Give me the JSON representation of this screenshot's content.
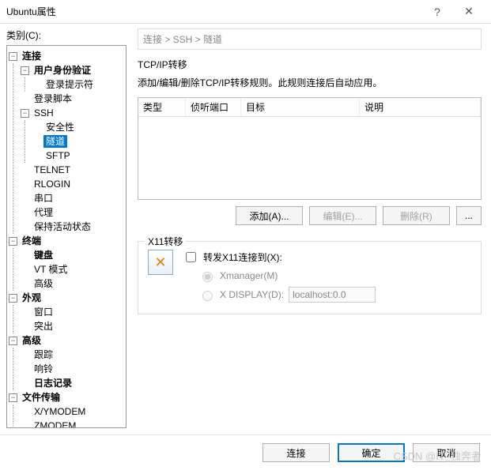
{
  "title": "Ubuntu属性",
  "leftLabel": "类别(C):",
  "breadcrumb": "连接 > SSH > 隧道",
  "tcpip": {
    "title": "TCP/IP转移",
    "desc": "添加/编辑/删除TCP/IP转移规则。此规则连接后自动应用。",
    "cols": {
      "type": "类型",
      "port": "侦听端口",
      "dest": "目标",
      "desc": "说明"
    },
    "btnAdd": "添加(A)...",
    "btnEdit": "编辑(E)...",
    "btnRemove": "删除(R)",
    "btnMore": "..."
  },
  "x11": {
    "title": "X11转移",
    "check": "转发X11连接到(X):",
    "optXmanager": "Xmanager(M)",
    "optDisplay": "X DISPLAY(D):",
    "displayValue": "localhost:0.0"
  },
  "footer": {
    "connect": "连接",
    "ok": "确定",
    "cancel": "取消"
  },
  "watermark": "CSDN @IT_独奔者",
  "tree": {
    "conn": "连接",
    "auth": "用户身份验证",
    "loginPrompt": "登录提示符",
    "loginScript": "登录脚本",
    "ssh": "SSH",
    "security": "安全性",
    "tunnel": "隧道",
    "sftp": "SFTP",
    "telnet": "TELNET",
    "rlogin": "RLOGIN",
    "serial": "串口",
    "proxy": "代理",
    "keepalive": "保持活动状态",
    "terminal": "终端",
    "keyboard": "键盘",
    "vtmode": "VT 模式",
    "advanced1": "高级",
    "appearance": "外观",
    "window": "窗口",
    "highlight": "突出",
    "advanced2": "高级",
    "trace": "跟踪",
    "bell": "响铃",
    "logging": "日志记录",
    "filetransfer": "文件传输",
    "xymodem": "X/YMODEM",
    "zmodem": "ZMODEM"
  }
}
